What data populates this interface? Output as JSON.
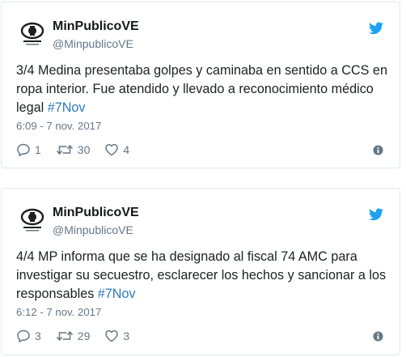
{
  "tweets": [
    {
      "name": "MinPublicoVE",
      "handle": "@MinpublicoVE",
      "text": "3/4 Medina presentaba golpes y caminaba en sentido a CCS en ropa interior. Fue atendido y llevado a reconocimiento médico legal ",
      "hashtag": "#7Nov",
      "time": "6:09 - 7 nov. 2017",
      "replies": "1",
      "retweets": "30",
      "likes": "4"
    },
    {
      "name": "MinPublicoVE",
      "handle": "@MinpublicoVE",
      "text": "4/4 MP informa que se ha designado al fiscal 74 AMC para investigar su secuestro, esclarecer los hechos y sancionar a los responsables ",
      "hashtag": "#7Nov",
      "time": "6:12 - 7 nov. 2017",
      "replies": "3",
      "retweets": "29",
      "likes": "3"
    }
  ],
  "colors": {
    "accent": "#1da1f2",
    "hashtag": "#2b7bb9",
    "muted": "#657786",
    "border": "#e1e8ed"
  },
  "icons": {
    "avatar": "minpublico-logo",
    "platform": "twitter-bird-icon",
    "reply": "reply-icon",
    "retweet": "retweet-icon",
    "like": "heart-icon",
    "info": "info-icon"
  }
}
